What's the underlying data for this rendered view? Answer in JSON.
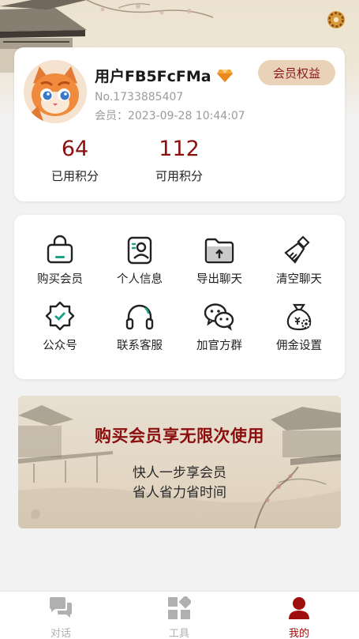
{
  "header": {
    "settings_icon": "gear-icon"
  },
  "profile": {
    "username": "用户FB5FcFMa",
    "badge_icon": "diamond-icon",
    "number": "No.1733885407",
    "member_since": "会员：2023-09-28 10:44:07",
    "benefits_label": "会员权益",
    "stats": [
      {
        "value": "64",
        "label": "已用积分"
      },
      {
        "value": "112",
        "label": "可用积分"
      }
    ]
  },
  "menu": {
    "items": [
      {
        "label": "购买会员",
        "icon": "shopping-bag-icon"
      },
      {
        "label": "个人信息",
        "icon": "id-card-icon"
      },
      {
        "label": "导出聊天",
        "icon": "folder-upload-icon"
      },
      {
        "label": "清空聊天",
        "icon": "broom-icon"
      },
      {
        "label": "公众号",
        "icon": "verified-badge-icon"
      },
      {
        "label": "联系客服",
        "icon": "headset-icon"
      },
      {
        "label": "加官方群",
        "icon": "wechat-icon"
      },
      {
        "label": "佣金设置",
        "icon": "money-bag-gear-icon"
      }
    ]
  },
  "banner": {
    "title": "购买会员享无限次使用",
    "line1": "快人一步享会员",
    "line2": "省人省力省时间"
  },
  "tabbar": {
    "tabs": [
      {
        "label": "对话",
        "icon": "chat-bubbles-icon",
        "active": false
      },
      {
        "label": "工具",
        "icon": "grid-tools-icon",
        "active": false
      },
      {
        "label": "我的",
        "icon": "user-icon",
        "active": true
      }
    ]
  },
  "colors": {
    "accent": "#8b1010",
    "badge_bg": "#e9d2b7",
    "inactive": "#b0b0b0",
    "active_tab": "#a00d0d"
  }
}
